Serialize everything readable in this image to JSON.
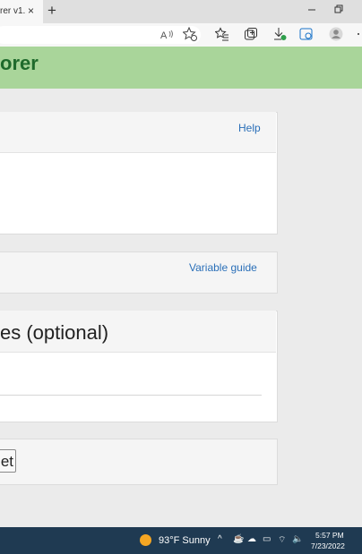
{
  "browser": {
    "tab_title": "rer v1.",
    "tab_close": "×",
    "new_tab": "+",
    "toolbar_icons": [
      "read-aloud-icon",
      "add-favorite-icon",
      "favorites-icon",
      "collections-icon",
      "downloads-icon",
      "edge-sidebar-icon",
      "profile-icon"
    ]
  },
  "header": {
    "title": "orer"
  },
  "panel_top": {
    "help_link": "Help"
  },
  "panel_vars": {
    "guide_link": "Variable guide"
  },
  "panel_optional": {
    "title": "es (optional)"
  },
  "actions": {
    "button_label": "et"
  },
  "taskbar": {
    "weather_text": "93°F  Sunny",
    "time": "5:57 PM",
    "date": "7/23/2022",
    "tray": [
      "^",
      "☕",
      "☁",
      "▭",
      "⌔",
      "🔈"
    ]
  },
  "colors": {
    "banner": "#a9d59a",
    "banner_text": "#1f6a2c",
    "link": "#2a6fb8",
    "taskbar": "#1f3a52"
  }
}
